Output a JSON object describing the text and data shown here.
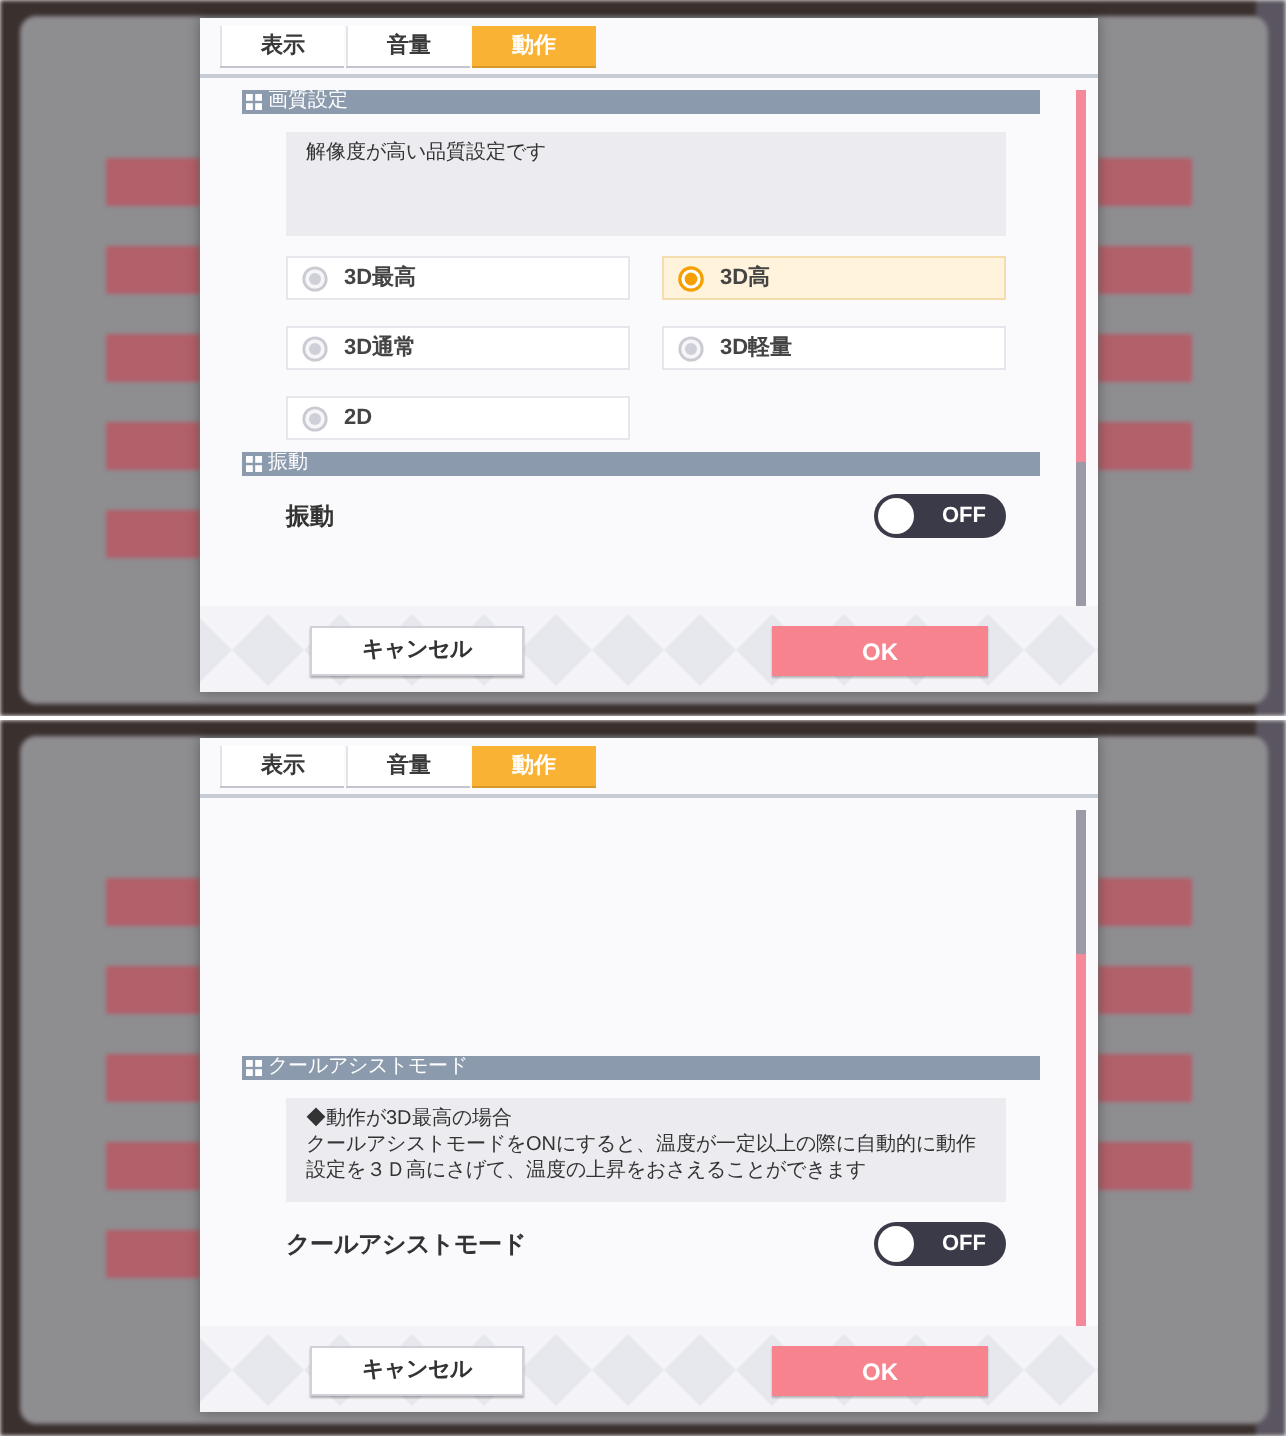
{
  "screens": [
    {
      "tabs": [
        {
          "label": "表示",
          "selected": false
        },
        {
          "label": "音量",
          "selected": false
        },
        {
          "label": "動作",
          "selected": true
        }
      ],
      "sections": [
        {
          "title": "画質設定",
          "items": [
            {
              "kind": "description",
              "lines": [
                "解像度が高い品質設定です"
              ]
            },
            {
              "kind": "radio_group",
              "options": [
                {
                  "label": "3D最高",
                  "selected": false
                },
                {
                  "label": "3D高",
                  "selected": true
                },
                {
                  "label": "3D通常",
                  "selected": false
                },
                {
                  "label": "3D軽量",
                  "selected": false
                },
                {
                  "label": "2D",
                  "selected": false
                }
              ]
            }
          ]
        },
        {
          "title": "振動",
          "items": [
            {
              "kind": "toggle",
              "label": "振動",
              "on": false,
              "state_text": "OFF"
            }
          ]
        }
      ],
      "buttons": [
        {
          "kind": "cancel",
          "label": "キャンセル"
        },
        {
          "kind": "confirm",
          "label": "OK"
        }
      ]
    },
    {
      "tabs": [
        {
          "label": "表示",
          "selected": false
        },
        {
          "label": "音量",
          "selected": false
        },
        {
          "label": "動作",
          "selected": true
        }
      ],
      "sections": [
        {
          "title": "クールアシストモード",
          "items": [
            {
              "kind": "description",
              "lines": [
                "◆動作が3D最高の場合",
                "クールアシストモードをONにすると、温度が一定以上の際に自動的に動作設定を３Ｄ高にさげて、温度の上昇をおさえることができます"
              ]
            },
            {
              "kind": "toggle",
              "label": "クールアシストモード",
              "on": false,
              "state_text": "OFF"
            }
          ]
        }
      ],
      "buttons": [
        {
          "kind": "cancel",
          "label": "キャンセル"
        },
        {
          "kind": "confirm",
          "label": "OK"
        }
      ]
    }
  ]
}
